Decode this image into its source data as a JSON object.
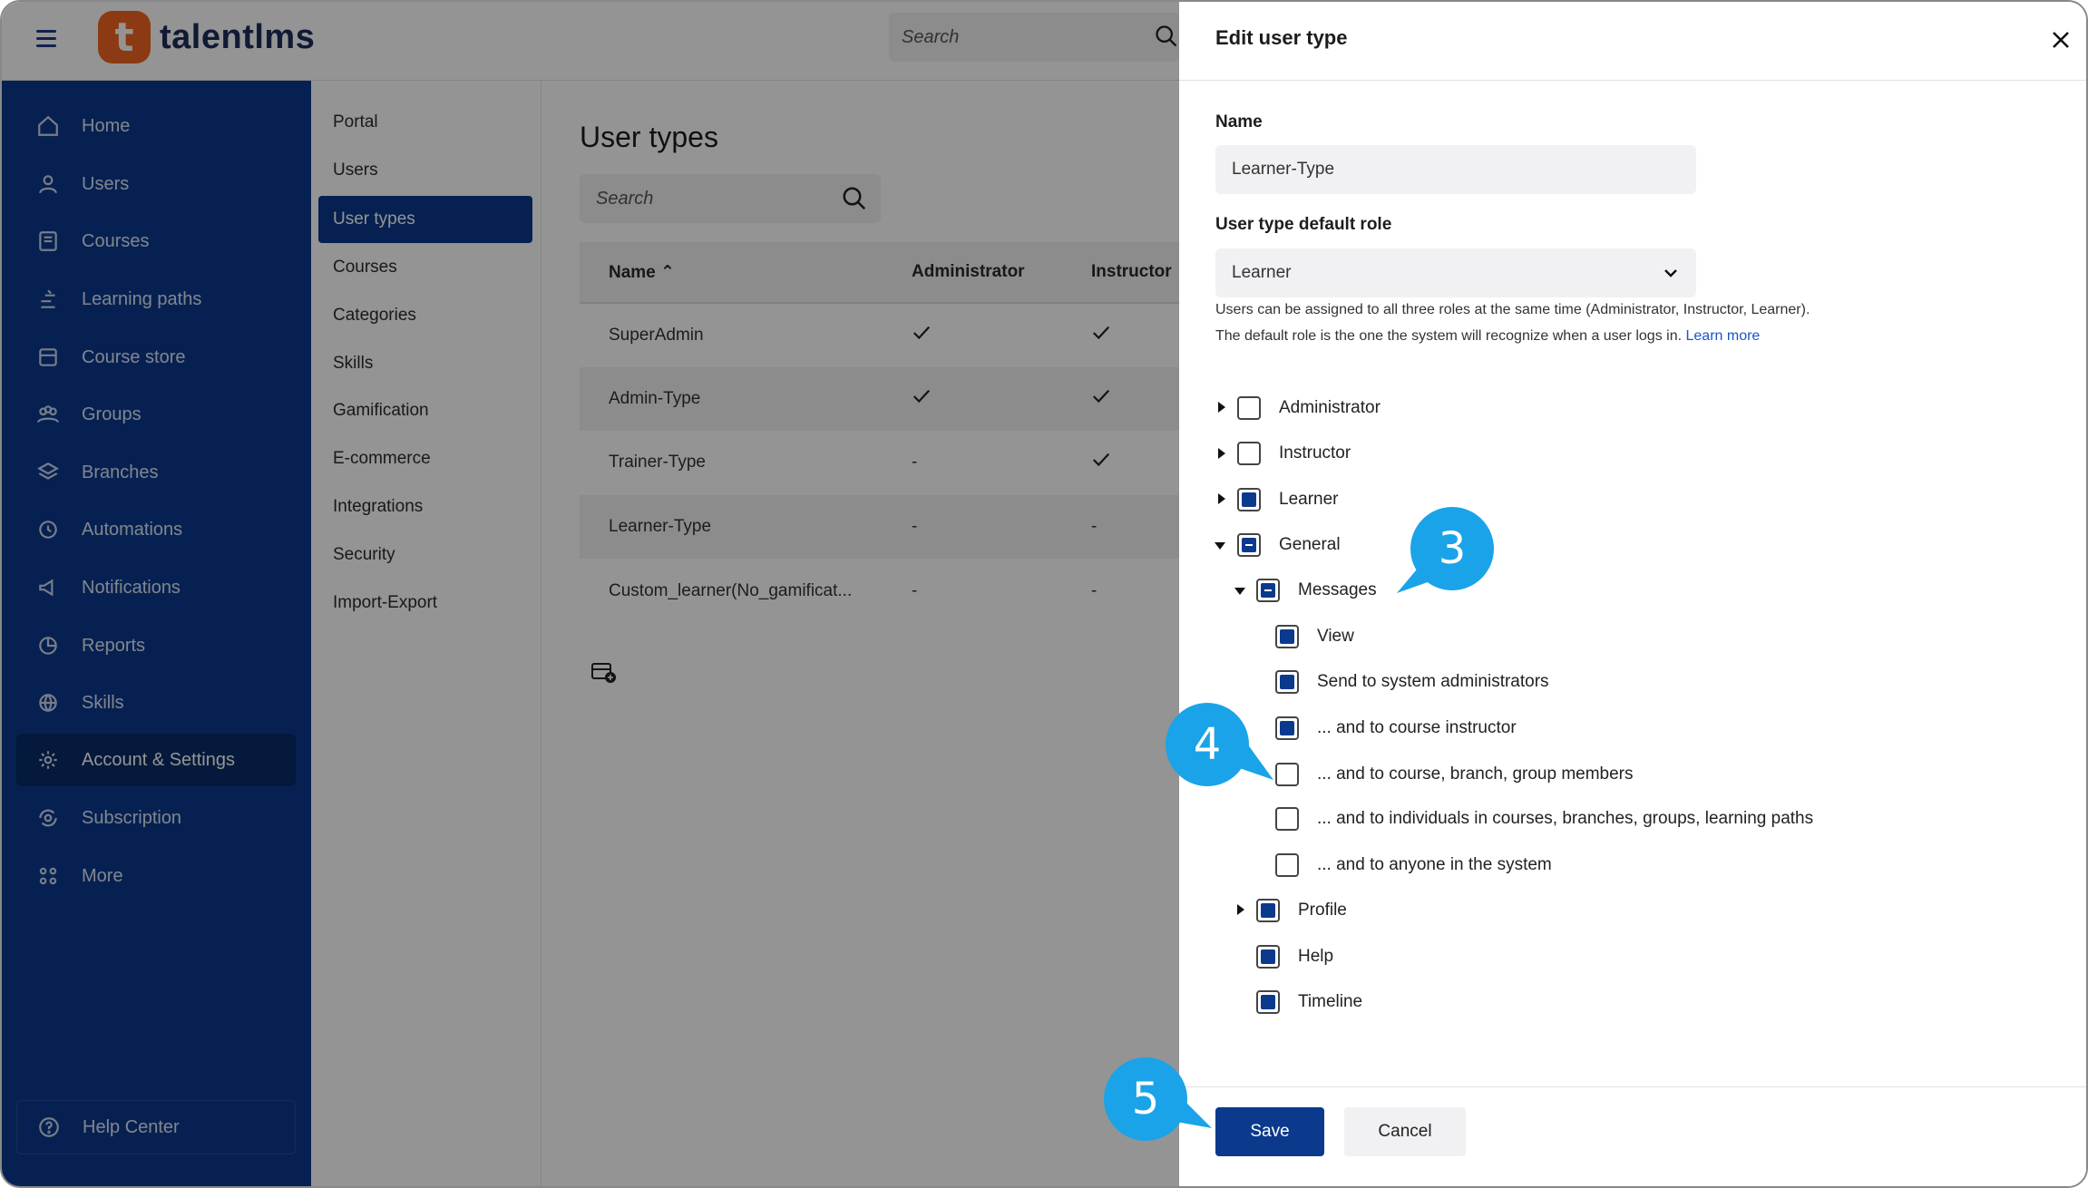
{
  "app": {
    "logo_letter": "t",
    "logo_text": "talentlms",
    "brand_color": "#f26522",
    "nav_color": "#0b3a8c"
  },
  "top_search": {
    "placeholder": "Search"
  },
  "sidebar": {
    "items": [
      {
        "label": "Home",
        "icon": "home-icon"
      },
      {
        "label": "Users",
        "icon": "user-icon"
      },
      {
        "label": "Courses",
        "icon": "book-icon"
      },
      {
        "label": "Learning paths",
        "icon": "path-icon"
      },
      {
        "label": "Course store",
        "icon": "store-icon"
      },
      {
        "label": "Groups",
        "icon": "groups-icon"
      },
      {
        "label": "Branches",
        "icon": "layers-icon"
      },
      {
        "label": "Automations",
        "icon": "automation-icon"
      },
      {
        "label": "Notifications",
        "icon": "megaphone-icon"
      },
      {
        "label": "Reports",
        "icon": "pie-chart-icon"
      },
      {
        "label": "Skills",
        "icon": "globe-icon"
      },
      {
        "label": "Account & Settings",
        "icon": "gear-icon"
      },
      {
        "label": "Subscription",
        "icon": "refresh-gear-icon"
      },
      {
        "label": "More",
        "icon": "grid-icon"
      }
    ],
    "active": "Account & Settings",
    "help_center": "Help Center"
  },
  "subnav": {
    "items": [
      "Portal",
      "Users",
      "User types",
      "Courses",
      "Categories",
      "Skills",
      "Gamification",
      "E-commerce",
      "Integrations",
      "Security",
      "Import-Export"
    ],
    "active": "User types"
  },
  "main": {
    "title": "User types",
    "search_placeholder": "Search",
    "table": {
      "headers": {
        "name": "Name",
        "admin": "Administrator",
        "instructor": "Instructor"
      },
      "rows": [
        {
          "name": "SuperAdmin",
          "admin": "check",
          "instructor": "check"
        },
        {
          "name": "Admin-Type",
          "admin": "check",
          "instructor": "check"
        },
        {
          "name": "Trainer-Type",
          "admin": "-",
          "instructor": "check"
        },
        {
          "name": "Learner-Type",
          "admin": "-",
          "instructor": "-"
        },
        {
          "name": "Custom_learner(No_gamificat...",
          "admin": "-",
          "instructor": "-"
        }
      ]
    }
  },
  "drawer": {
    "title": "Edit user type",
    "name_label": "Name",
    "name_value": "Learner-Type",
    "role_label": "User type default role",
    "role_value": "Learner",
    "help_line1": "Users can be assigned to all three roles at the same time (Administrator, Instructor, Learner).",
    "help_line2": "The default role is the one the system will recognize when a user logs in.",
    "help_link": "Learn more",
    "tree": {
      "administrator": "Administrator",
      "instructor": "Instructor",
      "learner": "Learner",
      "general": "General",
      "messages": "Messages",
      "view": "View",
      "send_admins": "Send to system administrators",
      "course_instructor": "... and to course instructor",
      "course_members": "... and to course, branch, group members",
      "individuals": "... and to individuals in courses, branches, groups, learning paths",
      "anyone": "... and to anyone in the system",
      "profile": "Profile",
      "help": "Help",
      "timeline": "Timeline"
    },
    "save": "Save",
    "cancel": "Cancel"
  },
  "callouts": {
    "c3": "3",
    "c4": "4",
    "c5": "5",
    "color": "#1aa3e8"
  }
}
